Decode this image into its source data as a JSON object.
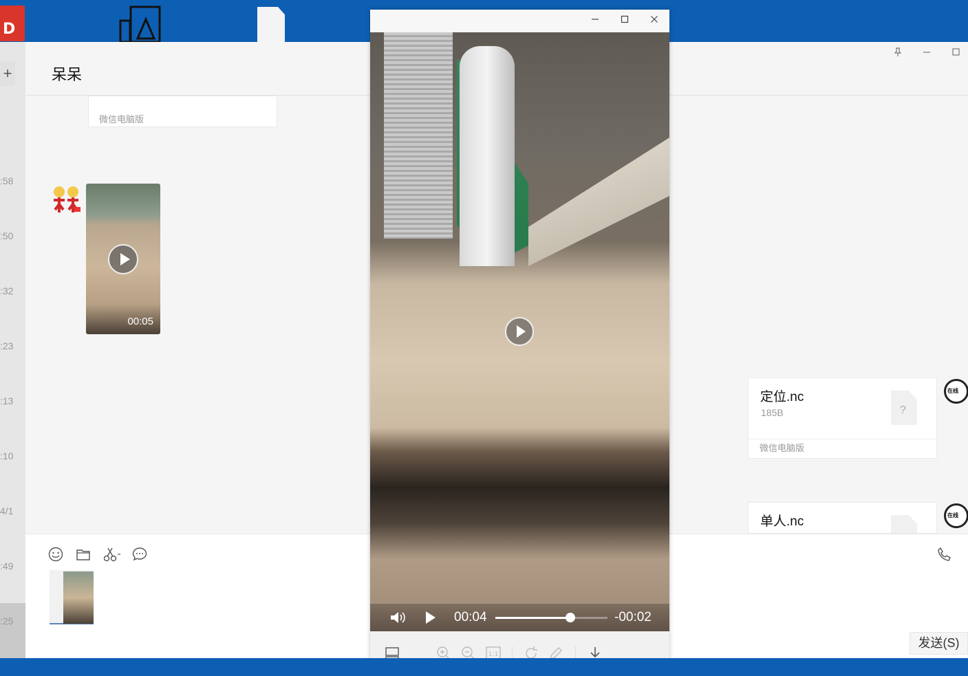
{
  "desktop": {
    "icons": [
      "pdf-app-icon",
      "cad-app-icon",
      "blank-document-icon"
    ],
    "red_app_letter": "D"
  },
  "chat": {
    "title": "呆呆",
    "left_times": [
      ":58",
      ":50",
      ":32",
      ":23",
      ":13",
      ":10",
      "4/1",
      ":49",
      ":25"
    ],
    "add_label": "+",
    "first_card_source": "微信电脑版",
    "video_duration": "00:05",
    "files": [
      {
        "name": "定位.nc",
        "size": "185B",
        "icon_mark": "?",
        "source": "微信电脑版"
      },
      {
        "name": "单人.nc",
        "size": "",
        "icon_mark": "?"
      }
    ],
    "avatar_text": "在线",
    "send_label": "发送(S)"
  },
  "player": {
    "current_time": "00:04",
    "remaining_time": "-00:02",
    "progress": 0.67,
    "icons": [
      "layout-icon",
      "zoom-in-icon",
      "zoom-out-icon",
      "actual-size-icon",
      "rotate-icon",
      "edit-icon",
      "download-icon"
    ],
    "actual_size_label": "1:1"
  }
}
